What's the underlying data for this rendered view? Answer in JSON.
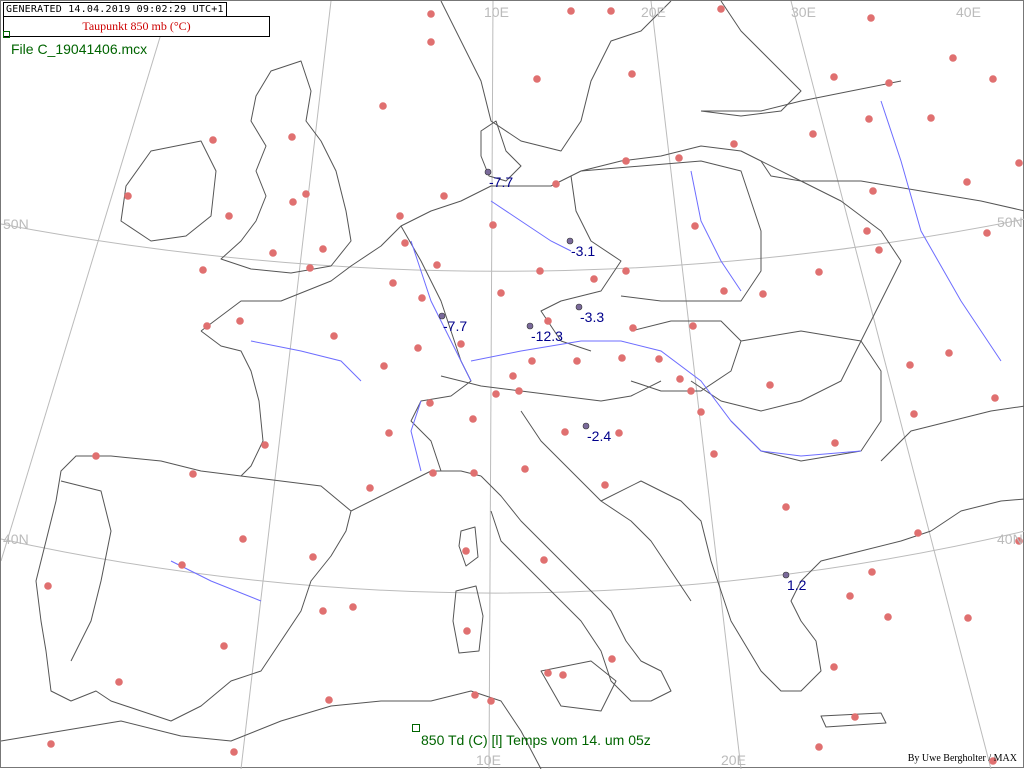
{
  "header": {
    "generated": "GENERATED 14.04.2019 09:02:29 UTC+1",
    "parameter": "Taupunkt 850 mb (°C)",
    "parameter_color": "#cc0000",
    "file": "File C_19041406.mcx"
  },
  "footer": {
    "caption": "850 Td (C) [l]  Temps vom 14. um 05z",
    "author": "By Uwe Bergholter / MAX"
  },
  "grid_labels": {
    "lon_top": [
      "10E",
      "20E",
      "30E",
      "40E"
    ],
    "lon_bottom": [
      "10E",
      "20E"
    ],
    "lat_left": [
      "50N",
      "40N"
    ],
    "lat_right": [
      "50N",
      "40N"
    ]
  },
  "colors": {
    "station": "#e07070",
    "value_text": "#00008b",
    "coast": "#555555",
    "river": "#6d6dff",
    "grid": "#bbbbbb"
  },
  "observations": [
    {
      "value": "-7.7",
      "lon": 10.2,
      "lat": 53.6
    },
    {
      "value": "-3.1",
      "lon": 14.4,
      "lat": 51.1
    },
    {
      "value": "-3.3",
      "lon": 14.8,
      "lat": 49.0
    },
    {
      "value": "-7.7",
      "lon": 7.0,
      "lat": 48.9
    },
    {
      "value": "-12.3",
      "lon": 11.6,
      "lat": 48.2
    },
    {
      "value": "-2.4",
      "lon": 14.6,
      "lat": 46.1
    },
    {
      "value": "1.2",
      "lon": 22.9,
      "lat": 40.6
    }
  ]
}
